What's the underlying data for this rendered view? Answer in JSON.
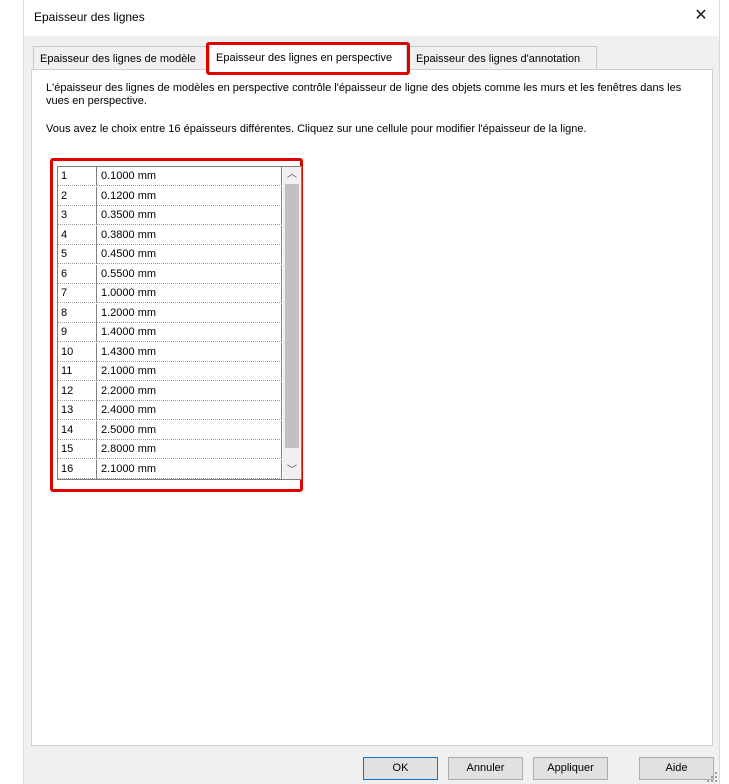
{
  "window": {
    "title": "Epaisseur des lignes"
  },
  "tabs": [
    {
      "label": "Epaisseur des lignes de modèle"
    },
    {
      "label": "Epaisseur des lignes en perspective"
    },
    {
      "label": "Epaisseur des lignes d'annotation"
    }
  ],
  "content": {
    "description": "L'épaisseur des lignes de modèles en perspective contrôle l'épaisseur de ligne des objets comme les murs et les fenêtres dans les vues en perspective.",
    "instruction": "Vous avez le choix entre 16 épaisseurs différentes. Cliquez sur une cellule pour modifier l'épaisseur de la ligne."
  },
  "grid": {
    "rows": [
      {
        "num": "1",
        "value": "0.1000 mm"
      },
      {
        "num": "2",
        "value": "0.1200 mm"
      },
      {
        "num": "3",
        "value": "0.3500 mm"
      },
      {
        "num": "4",
        "value": "0.3800 mm"
      },
      {
        "num": "5",
        "value": "0.4500 mm"
      },
      {
        "num": "6",
        "value": "0.5500 mm"
      },
      {
        "num": "7",
        "value": "1.0000 mm"
      },
      {
        "num": "8",
        "value": "1.2000 mm"
      },
      {
        "num": "9",
        "value": "1.4000 mm"
      },
      {
        "num": "10",
        "value": "1.4300 mm"
      },
      {
        "num": "11",
        "value": "2.1000 mm"
      },
      {
        "num": "12",
        "value": "2.2000 mm"
      },
      {
        "num": "13",
        "value": "2.4000 mm"
      },
      {
        "num": "14",
        "value": "2.5000 mm"
      },
      {
        "num": "15",
        "value": "2.8000 mm"
      },
      {
        "num": "16",
        "value": "2.1000 mm"
      }
    ]
  },
  "buttons": {
    "ok": "OK",
    "cancel": "Annuler",
    "apply": "Appliquer",
    "help": "Aide"
  },
  "colors": {
    "highlight": "#e00000",
    "dialog_bg": "#f0f0f0"
  }
}
